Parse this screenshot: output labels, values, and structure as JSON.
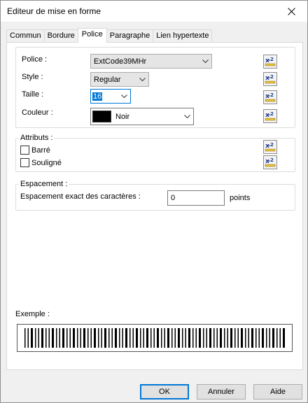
{
  "window": {
    "title": "Editeur de mise en forme"
  },
  "tabs": [
    {
      "label": "Commun",
      "active": false
    },
    {
      "label": "Bordure",
      "active": false
    },
    {
      "label": "Police",
      "active": true
    },
    {
      "label": "Paragraphe",
      "active": false
    },
    {
      "label": "Lien hypertexte",
      "active": false
    }
  ],
  "font_group": {
    "police_label": "Police :",
    "police_value": "ExtCode39MHr",
    "style_label": "Style :",
    "style_value": "Regular",
    "taille_label": "Taille :",
    "taille_value": "16",
    "couleur_label": "Couleur :",
    "couleur_value": "Noir",
    "couleur_swatch": "#000000"
  },
  "attributs": {
    "legend": "Attributs :",
    "barre_label": "Barré",
    "barre_checked": false,
    "souligne_label": "Souligné",
    "souligne_checked": false
  },
  "espacement": {
    "legend": "Espacement :",
    "label": "Espacement exact des caractères :",
    "value": "0",
    "unit": "points"
  },
  "exemple": {
    "label": "Exemple :"
  },
  "buttons": {
    "ok": "OK",
    "annuler": "Annuler",
    "aide": "Aide"
  },
  "icons": {
    "formula": "formula-icon",
    "close": "close-icon",
    "dropdown": "chevron-down-icon"
  },
  "colors": {
    "accent": "#0078d7",
    "selection": "#0078d7"
  }
}
